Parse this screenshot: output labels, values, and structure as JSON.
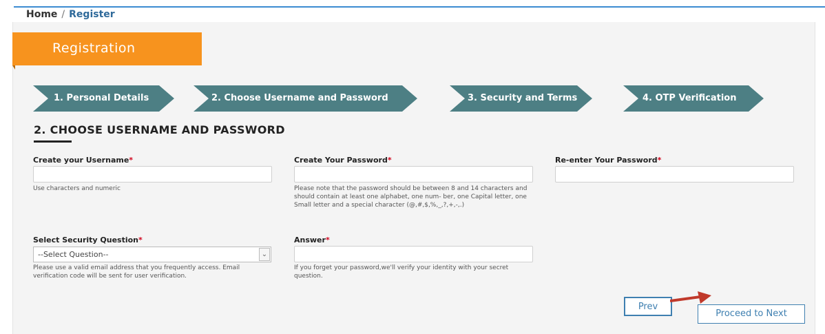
{
  "breadcrumb": {
    "home": "Home",
    "separator": "/",
    "current": "Register"
  },
  "registration_tab": {
    "label": "Registration"
  },
  "steps": [
    {
      "label": "1. Personal Details"
    },
    {
      "label": "2. Choose Username and Password"
    },
    {
      "label": "3. Security and Terms"
    },
    {
      "label": "4. OTP Verification"
    }
  ],
  "section": {
    "title": "2. CHOOSE USERNAME AND PASSWORD"
  },
  "form": {
    "username": {
      "label": "Create your Username",
      "required_mark": "*",
      "value": "",
      "help": "Use characters and numeric"
    },
    "password": {
      "label": "Create Your Password",
      "required_mark": "*",
      "value": "",
      "help": "Please note that the password should be between 8 and 14 characters and should contain at least one alphabet, one num- ber, one Capital letter, one Small letter and a special character (@,#,$,%,_,?,+,-,.)"
    },
    "reenter_password": {
      "label": "Re-enter Your Password",
      "required_mark": "*",
      "value": ""
    },
    "security_question": {
      "label": "Select Security Question",
      "required_mark": "*",
      "selected": "--Select Question--",
      "help": "Please use a valid email address that you frequently access. Email verification code will be sent for user verification."
    },
    "answer": {
      "label": "Answer",
      "required_mark": "*",
      "value": "",
      "help": "If you forget your password,we'll verify your identity with your secret question."
    }
  },
  "buttons": {
    "prev": "Prev",
    "next": "Proceed to Next"
  },
  "colors": {
    "accent_orange": "#f7931e",
    "step_teal": "#4d7f84",
    "required_red": "#d0021b",
    "button_blue": "#3e7fb0",
    "annotation_arrow": "#c0392b"
  },
  "icons": {
    "select_arrow": "chevron-down-icon",
    "annotation": "arrow-pointer-icon"
  }
}
